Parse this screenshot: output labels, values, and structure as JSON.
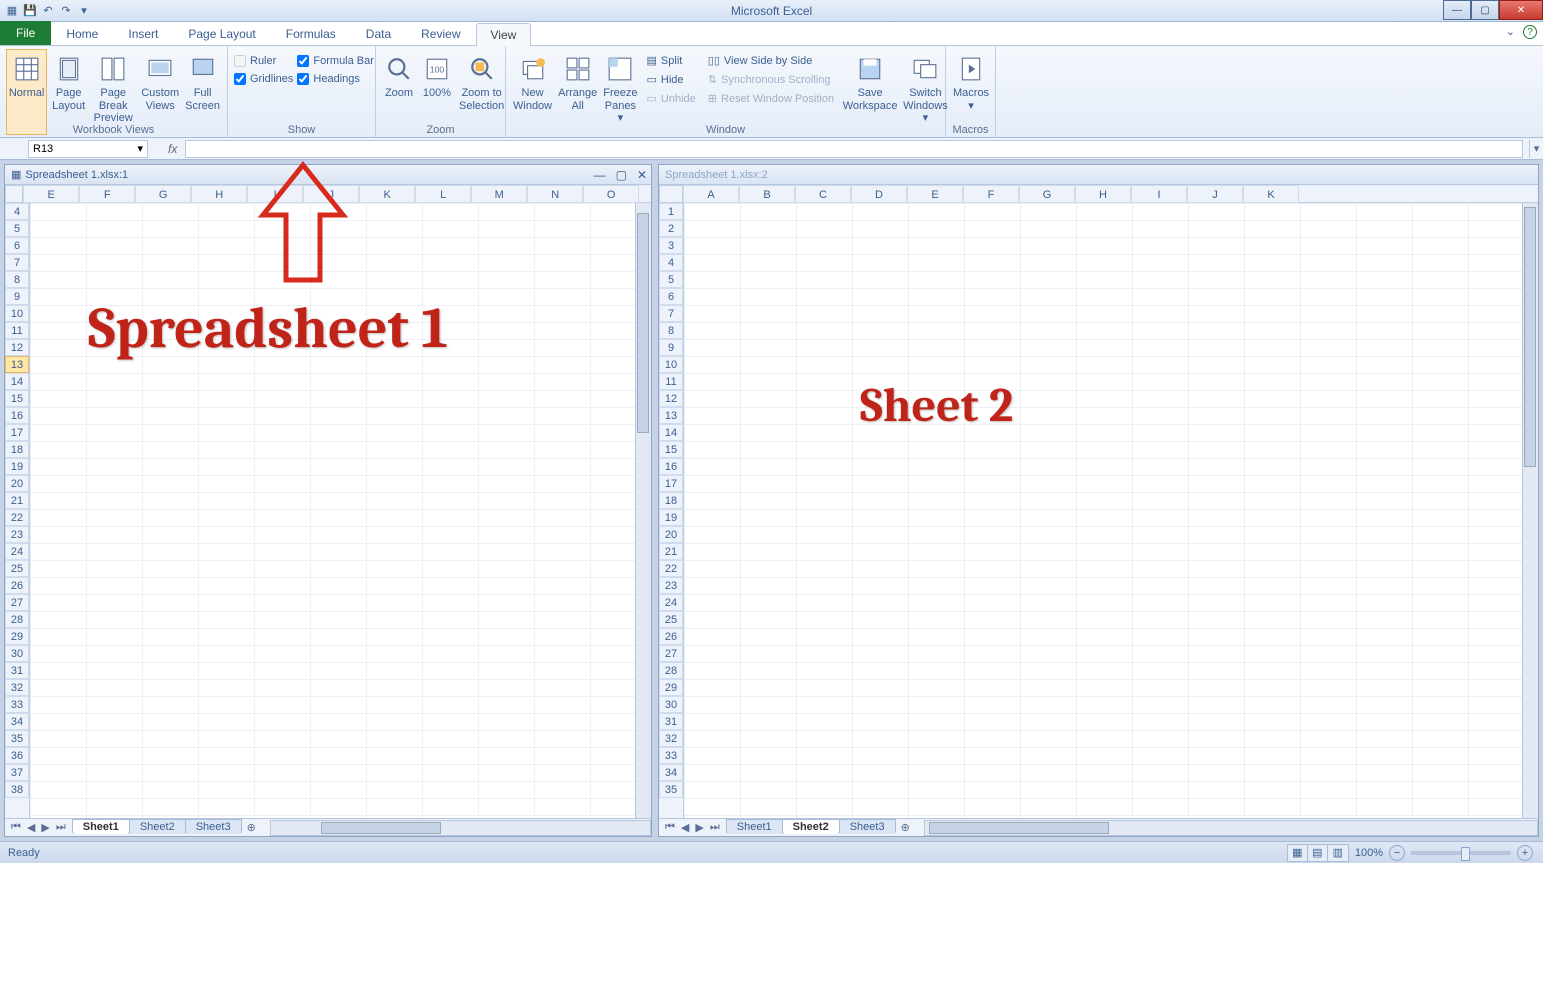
{
  "app_title": "Microsoft Excel",
  "qat": {
    "save_icon": "save",
    "undo_icon": "undo",
    "redo_icon": "redo"
  },
  "tabs": {
    "file": "File",
    "home": "Home",
    "insert": "Insert",
    "page_layout": "Page Layout",
    "formulas": "Formulas",
    "data": "Data",
    "review": "Review",
    "view": "View",
    "active": "View"
  },
  "ribbon": {
    "workbook_views": {
      "label": "Workbook Views",
      "normal": "Normal",
      "page_layout": "Page\nLayout",
      "page_break": "Page Break\nPreview",
      "custom_views": "Custom\nViews",
      "full_screen": "Full\nScreen"
    },
    "show": {
      "label": "Show",
      "ruler": "Ruler",
      "gridlines": "Gridlines",
      "formula_bar": "Formula Bar",
      "headings": "Headings"
    },
    "zoom": {
      "label": "Zoom",
      "zoom": "Zoom",
      "hundred": "100%",
      "to_selection": "Zoom to\nSelection"
    },
    "window": {
      "label": "Window",
      "new_window": "New\nWindow",
      "arrange_all": "Arrange\nAll",
      "freeze_panes": "Freeze\nPanes",
      "split": "Split",
      "hide": "Hide",
      "unhide": "Unhide",
      "side_by_side": "View Side by Side",
      "sync_scroll": "Synchronous Scrolling",
      "reset_pos": "Reset Window Position",
      "save_workspace": "Save\nWorkspace",
      "switch_windows": "Switch\nWindows"
    },
    "macros": {
      "label": "Macros",
      "macros": "Macros"
    }
  },
  "namebox": "R13",
  "fx_label": "fx",
  "pane1": {
    "title": "Spreadsheet 1.xlsx:1",
    "columns": [
      "E",
      "F",
      "G",
      "H",
      "I",
      "J",
      "K",
      "L",
      "M",
      "N",
      "O"
    ],
    "rows": [
      4,
      5,
      6,
      7,
      8,
      9,
      10,
      11,
      12,
      13,
      14,
      15,
      16,
      17,
      18,
      19,
      20,
      21,
      22,
      23,
      24,
      25,
      26,
      27,
      28,
      29,
      30,
      31,
      32,
      33,
      34,
      35,
      36,
      37,
      38
    ],
    "selected_row": 13,
    "tabs": [
      "Sheet1",
      "Sheet2",
      "Sheet3"
    ],
    "active_tab": "Sheet1"
  },
  "pane2": {
    "title": "Spreadsheet 1.xlsx:2",
    "columns": [
      "A",
      "B",
      "C",
      "D",
      "E",
      "F",
      "G",
      "H",
      "I",
      "J",
      "K"
    ],
    "rows": [
      1,
      2,
      3,
      4,
      5,
      6,
      7,
      8,
      9,
      10,
      11,
      12,
      13,
      14,
      15,
      16,
      17,
      18,
      19,
      20,
      21,
      22,
      23,
      24,
      25,
      26,
      27,
      28,
      29,
      30,
      31,
      32,
      33,
      34,
      35
    ],
    "tabs": [
      "Sheet1",
      "Sheet2",
      "Sheet3"
    ],
    "active_tab": "Sheet2"
  },
  "status": {
    "ready": "Ready",
    "zoom": "100%"
  },
  "annotations": {
    "spreadsheet1": "Spreadsheet 1",
    "sheet2": "Sheet 2"
  }
}
